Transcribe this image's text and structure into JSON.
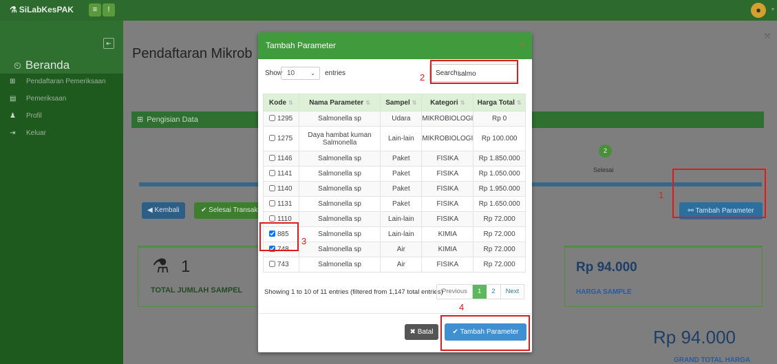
{
  "topbar": {
    "brand": "SiLabKesPAK",
    "menu_icon": "≡",
    "info_icon": "!"
  },
  "sidebar": {
    "title": "Beranda",
    "items": [
      {
        "label": "Pendaftaran Pemeriksaan",
        "icon": "plus-square-icon"
      },
      {
        "label": "Pemeriksaan",
        "icon": "list-icon"
      },
      {
        "label": "Profil",
        "icon": "user-icon"
      },
      {
        "label": "Keluar",
        "icon": "sign-out-icon"
      }
    ]
  },
  "main": {
    "page_title": "Pendaftaran Mikrob",
    "panel_title": "Pengisian Data",
    "step_number": "2",
    "step_label": "Selesai",
    "btn_kembali": "Kembali",
    "btn_selesai": "Selesai Transaksi",
    "btn_tambah": "Tambah Parameter",
    "total_count": "1",
    "total_label": "TOTAL JUMLAH SAMPEL",
    "harga_sample": "Rp  94.000",
    "harga_label": "HARGA SAMPLE",
    "grand_total": "Rp   94.000",
    "grand_label": "GRAND TOTAL HARGA"
  },
  "modal": {
    "title": "Tambah Parameter",
    "show_label": "Show",
    "show_value": "10",
    "entries_label": "entries",
    "search_label": "Search:",
    "search_value": "salmo",
    "columns": [
      "Kode",
      "Nama Parameter",
      "Sampel",
      "Kategori",
      "Harga Total"
    ],
    "rows": [
      {
        "kode": "1295",
        "nama": "Salmonella sp",
        "sampel": "Udara",
        "kategori": "MIKROBIOLOGI",
        "harga": "Rp 0",
        "checked": false
      },
      {
        "kode": "1275",
        "nama": "Daya hambat kuman Salmonella",
        "sampel": "Lain-lain",
        "kategori": "MIKROBIOLOGI",
        "harga": "Rp 100.000",
        "checked": false
      },
      {
        "kode": "1146",
        "nama": "Salmonella sp",
        "sampel": "Paket",
        "kategori": "FISIKA",
        "harga": "Rp 1.850.000",
        "checked": false
      },
      {
        "kode": "1141",
        "nama": "Salmonella sp",
        "sampel": "Paket",
        "kategori": "FISIKA",
        "harga": "Rp 1.050.000",
        "checked": false
      },
      {
        "kode": "1140",
        "nama": "Salmonella sp",
        "sampel": "Paket",
        "kategori": "FISIKA",
        "harga": "Rp 1.950.000",
        "checked": false
      },
      {
        "kode": "1131",
        "nama": "Salmonella sp",
        "sampel": "Paket",
        "kategori": "FISIKA",
        "harga": "Rp 1.650.000",
        "checked": false
      },
      {
        "kode": "1110",
        "nama": "Salmonella sp",
        "sampel": "Lain-lain",
        "kategori": "FISIKA",
        "harga": "Rp 72.000",
        "checked": false
      },
      {
        "kode": "885",
        "nama": "Salmonella sp",
        "sampel": "Lain-lain",
        "kategori": "KIMIA",
        "harga": "Rp 72.000",
        "checked": true
      },
      {
        "kode": "748",
        "nama": "Salmonella sp",
        "sampel": "Air",
        "kategori": "KIMIA",
        "harga": "Rp 72.000",
        "checked": true
      },
      {
        "kode": "743",
        "nama": "Salmonella sp",
        "sampel": "Air",
        "kategori": "FISIKA",
        "harga": "Rp 72.000",
        "checked": false
      }
    ],
    "info": "Showing 1 to 10 of 11 entries (filtered from 1,147 total entries)",
    "pager": {
      "prev": "Previous",
      "p1": "1",
      "p2": "2",
      "next": "Next"
    },
    "btn_batal": "Batal",
    "btn_add": "Tambah Parameter"
  },
  "annotations": {
    "n1": "1",
    "n2": "2",
    "n3": "3",
    "n4": "4"
  }
}
